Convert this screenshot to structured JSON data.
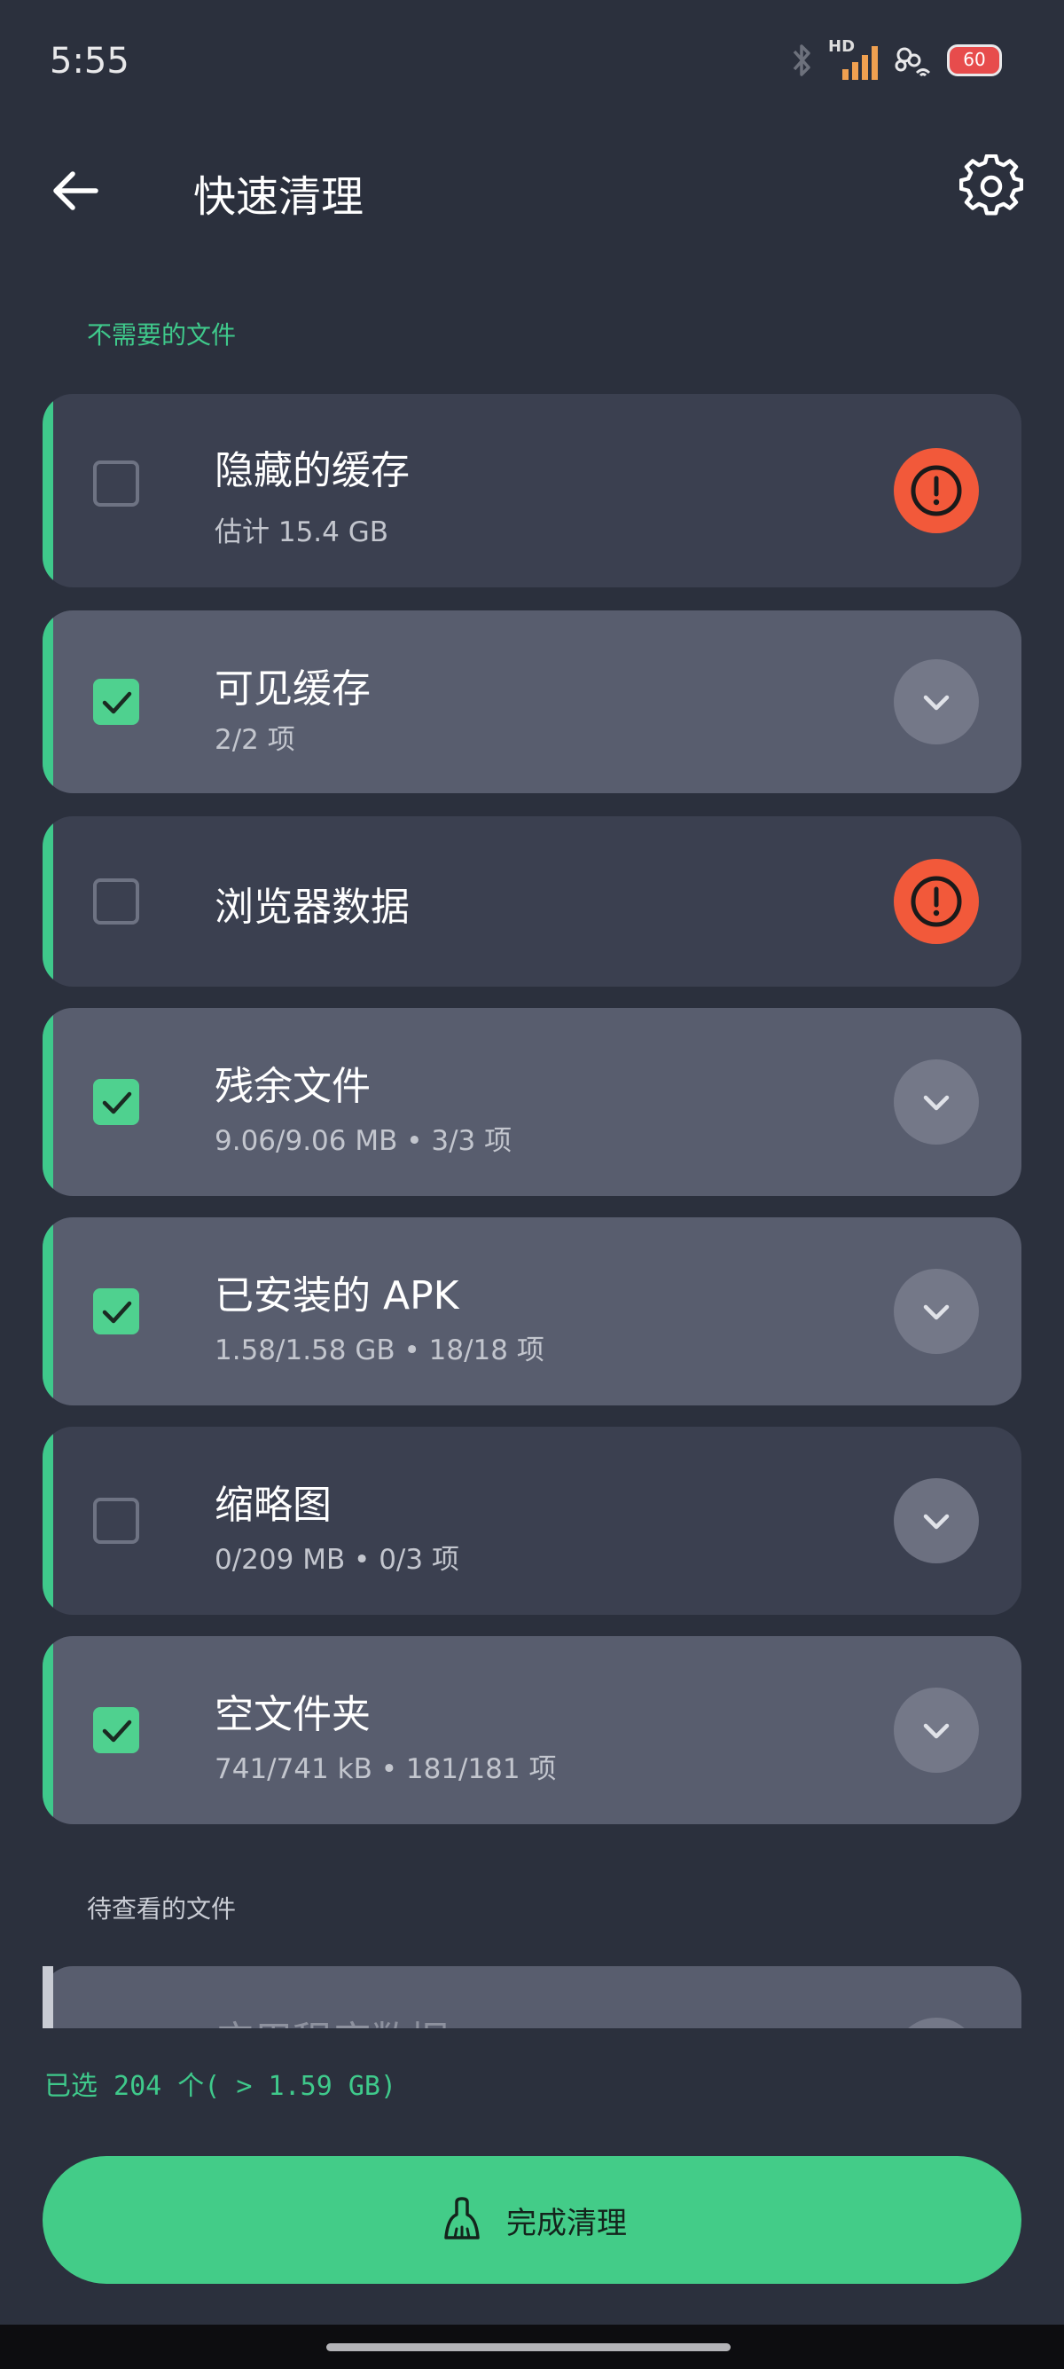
{
  "status_bar": {
    "time": "5:55",
    "network_label": "HD",
    "battery": "60",
    "icons": [
      "bluetooth-icon",
      "signal-icon",
      "wifi-icon",
      "battery-icon"
    ]
  },
  "app_bar": {
    "title": "快速清理",
    "back_icon": "arrow-left-icon",
    "settings_icon": "gear-icon"
  },
  "sections": {
    "unneeded": "不需要的文件",
    "review": "待查看的文件"
  },
  "items": [
    {
      "name": "隐藏的缓存",
      "sub": "估计 15.4 GB",
      "checked": false,
      "action": "warning"
    },
    {
      "name": "可见缓存",
      "sub": "2/2 项",
      "checked": true,
      "action": "expand"
    },
    {
      "name": "浏览器数据",
      "sub": "",
      "checked": false,
      "action": "warning"
    },
    {
      "name": "残余文件",
      "sub": "9.06/9.06 MB • 3/3 项",
      "checked": true,
      "action": "expand"
    },
    {
      "name": "已安装的 APK",
      "sub": "1.58/1.58 GB • 18/18 项",
      "checked": true,
      "action": "expand"
    },
    {
      "name": "缩略图",
      "sub": "0/209 MB • 0/3 项",
      "checked": false,
      "action": "expand"
    },
    {
      "name": "空文件夹",
      "sub": "741/741 kB • 181/181 项",
      "checked": true,
      "action": "expand"
    }
  ],
  "partial_item": {
    "name": "应用程序数据"
  },
  "footer": {
    "selected_info": "已选 204 个( > 1.59 GB)",
    "clean_button": "完成清理",
    "clean_icon": "broom-icon"
  },
  "colors": {
    "background": "#2b303d",
    "accent_green": "#3fc98b",
    "card": "#3b4050",
    "card_selected": "#585d6e",
    "warning": "#f2593a",
    "button": "#43cc88"
  }
}
